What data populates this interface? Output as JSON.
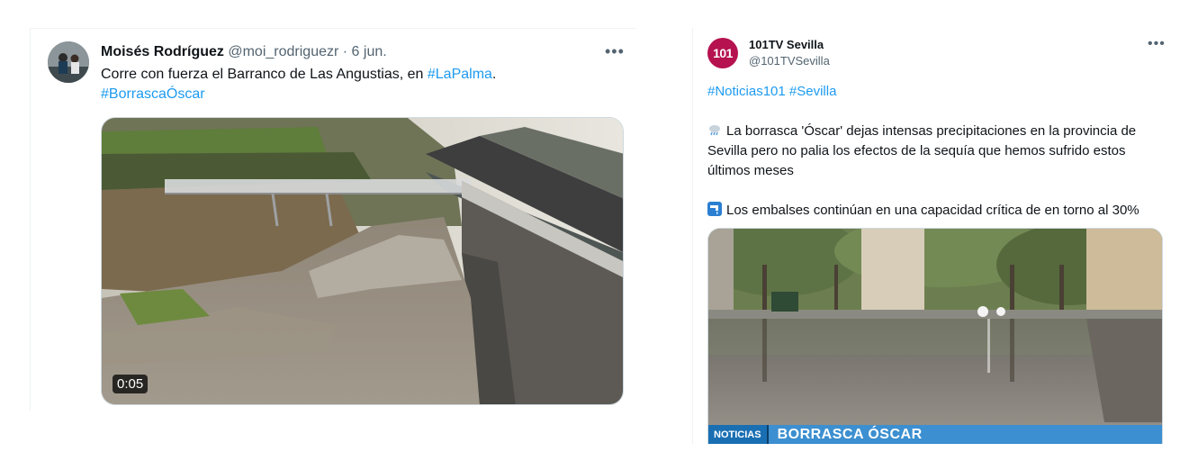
{
  "tweet1": {
    "author_name": "Moisés Rodríguez",
    "handle": "@moi_rodriguezr",
    "separator": "·",
    "date": "6 jun.",
    "more_icon": "more-horizontal-icon",
    "text_prefix": "Corre con fuerza el Barranco de Las Angustias, en ",
    "hashtag_1": "#LaPalma",
    "text_suffix": ".",
    "hashtag_2": "#BorrascaÓscar",
    "video_duration": "0:05"
  },
  "tweet2": {
    "author_name": "101TV Sevilla",
    "handle": "@101TVSevilla",
    "avatar_text": "101",
    "more_icon": "more-horizontal-icon",
    "hashtag_1": "#Noticias101",
    "hashtag_2": "#Sevilla",
    "paragraph_1": "La borrasca 'Óscar' dejas intensas precipitaciones en la provincia de Sevilla pero no palia los efectos de la sequía que hemos sufrido estos últimos meses",
    "paragraph_2": "Los embalses continúan en una capacidad crítica de en torno al 30%",
    "news_tag": "NOTICIAS",
    "news_title": "BORRASCA ÓSCAR",
    "brand_color": "#b5124f"
  }
}
